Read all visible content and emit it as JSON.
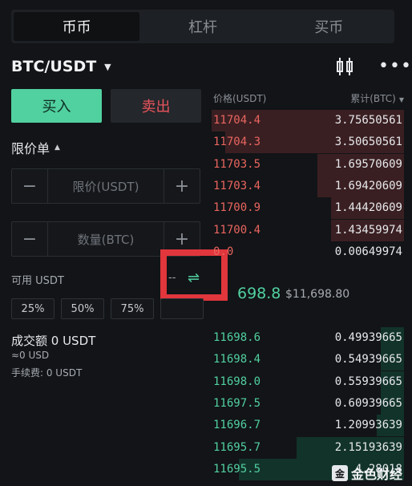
{
  "tabs": [
    {
      "label": "币币",
      "active": true
    },
    {
      "label": "杠杆",
      "active": false
    },
    {
      "label": "买币",
      "active": false
    }
  ],
  "pair": {
    "symbol": "BTC/USDT",
    "caret": "▼"
  },
  "icons": {
    "kline": "kline-icon",
    "more": "more-icon",
    "swap": "swap-icon"
  },
  "actions": {
    "buy_label": "买入",
    "sell_label": "卖出"
  },
  "order_type": {
    "label": "限价单"
  },
  "price_input": {
    "placeholder": "限价(USDT)",
    "minus": "−",
    "plus": "+"
  },
  "qty_input": {
    "placeholder": "数量(BTC)",
    "minus": "−",
    "plus": "+"
  },
  "available": {
    "label": "可用 USDT",
    "value": "--",
    "swap": "⇌"
  },
  "percent_buttons": [
    "25%",
    "50%",
    "75%",
    ""
  ],
  "summary": {
    "turnover": "成交额 0 USDT",
    "approx": "≈0 USD",
    "fee": "手续费: 0 USDT"
  },
  "orderbook": {
    "price_header": "价格(USDT)",
    "cum_header": "累计(BTC)",
    "asks": [
      {
        "price": "11704.4",
        "qty": "3.75650561",
        "depth": 1.0
      },
      {
        "price": "11704.3",
        "qty": "3.50650561",
        "depth": 0.93
      },
      {
        "price": "11703.5",
        "qty": "1.69570609",
        "depth": 0.45
      },
      {
        "price": "11703.4",
        "qty": "1.69420609",
        "depth": 0.45
      },
      {
        "price": "11700.9",
        "qty": "1.44420609",
        "depth": 0.38
      },
      {
        "price": "11700.4",
        "qty": "1.43459974",
        "depth": 0.38
      },
      {
        "price": "0.0",
        "qty": "0.00649974",
        "depth": 0.0
      }
    ],
    "last": {
      "price": "698.8",
      "usd": "$11,698.80"
    },
    "bids": [
      {
        "price": "11698.6",
        "qty": "0.49939665",
        "depth": 0.12
      },
      {
        "price": "11698.4",
        "qty": "0.54939665",
        "depth": 0.12
      },
      {
        "price": "11698.0",
        "qty": "0.55939665",
        "depth": 0.12
      },
      {
        "price": "11697.5",
        "qty": "0.60939665",
        "depth": 0.12
      },
      {
        "price": "11696.7",
        "qty": "1.20993639",
        "depth": 0.14
      },
      {
        "price": "11695.7",
        "qty": "2.15193639",
        "depth": 0.56
      },
      {
        "price": "11695.5",
        "qty": "4.28018",
        "depth": 0.86
      }
    ]
  },
  "watermark": {
    "logo": "金",
    "text": "金色财经"
  },
  "colors": {
    "buy": "#51d0a0",
    "sell": "#e9545d",
    "highlight": "#e0363c",
    "background": "#121417"
  }
}
